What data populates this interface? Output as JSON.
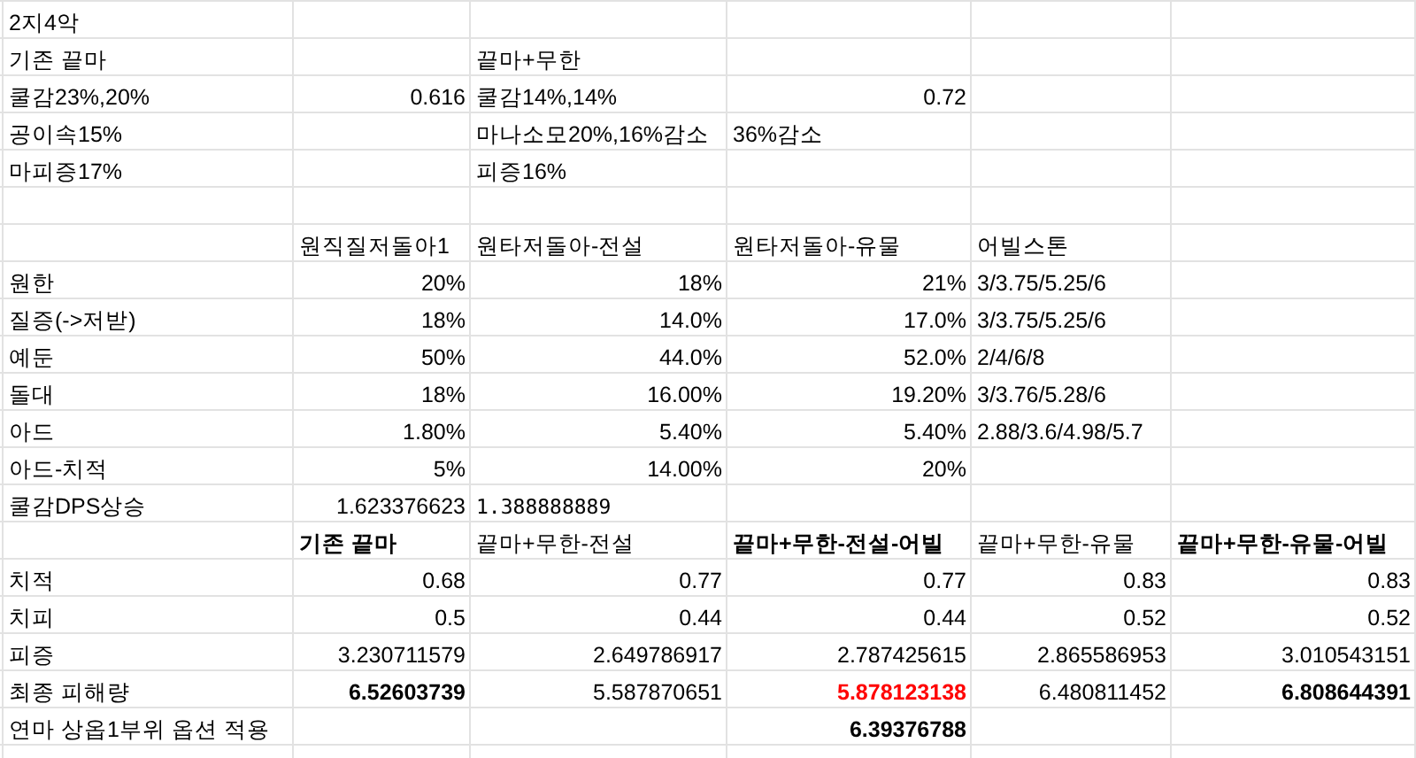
{
  "rows": [
    [
      {
        "t": "2지4악"
      },
      null,
      null,
      null,
      null,
      null
    ],
    [
      {
        "t": "기존 끝마"
      },
      null,
      {
        "t": "끝마+무한"
      },
      null,
      null,
      null
    ],
    [
      {
        "t": "쿨감23%,20%"
      },
      {
        "t": "0.616",
        "right": true
      },
      {
        "t": "쿨감14%,14%"
      },
      {
        "t": "0.72",
        "right": true
      },
      null,
      null
    ],
    [
      {
        "t": "공이속15%"
      },
      null,
      {
        "t": "마나소모20%,16%감소"
      },
      {
        "t": "36%감소"
      },
      null,
      null
    ],
    [
      {
        "t": "마피증17%"
      },
      null,
      {
        "t": "피증16%"
      },
      null,
      null,
      null
    ],
    [
      null,
      null,
      null,
      null,
      null,
      null
    ],
    [
      null,
      {
        "t": "원직질저돌아1"
      },
      {
        "t": "원타저돌아-전설"
      },
      {
        "t": "원타저돌아-유물"
      },
      {
        "t": "어빌스톤"
      },
      null
    ],
    [
      {
        "t": "원한"
      },
      {
        "t": "20%",
        "right": true
      },
      {
        "t": "18%",
        "right": true
      },
      {
        "t": "21%",
        "right": true
      },
      {
        "t": "3/3.75/5.25/6"
      },
      null
    ],
    [
      {
        "t": "질증(->저받)"
      },
      {
        "t": "18%",
        "right": true
      },
      {
        "t": "14.0%",
        "right": true
      },
      {
        "t": "17.0%",
        "right": true
      },
      {
        "t": "3/3.75/5.25/6"
      },
      null
    ],
    [
      {
        "t": "예둔"
      },
      {
        "t": "50%",
        "right": true
      },
      {
        "t": "44.0%",
        "right": true
      },
      {
        "t": "52.0%",
        "right": true
      },
      {
        "t": "2/4/6/8"
      },
      null
    ],
    [
      {
        "t": "돌대"
      },
      {
        "t": "18%",
        "right": true
      },
      {
        "t": "16.00%",
        "right": true
      },
      {
        "t": "19.20%",
        "right": true
      },
      {
        "t": "3/3.76/5.28/6"
      },
      null
    ],
    [
      {
        "t": "아드"
      },
      {
        "t": "1.80%",
        "right": true
      },
      {
        "t": "5.40%",
        "right": true
      },
      {
        "t": "5.40%",
        "right": true
      },
      {
        "t": "2.88/3.6/4.98/5.7"
      },
      null
    ],
    [
      {
        "t": "아드-치적"
      },
      {
        "t": "5%",
        "right": true
      },
      {
        "t": "14.00%",
        "right": true
      },
      {
        "t": "20%",
        "right": true
      },
      null,
      null
    ],
    [
      {
        "t": "쿨감DPS상승"
      },
      {
        "t": "1.623376623",
        "right": true
      },
      {
        "t": "1.388888889",
        "mono": true
      },
      null,
      null,
      null
    ],
    [
      null,
      {
        "t": "기존 끝마",
        "b": true
      },
      {
        "t": "끝마+무한-전설"
      },
      {
        "t": "끝마+무한-전설-어빌",
        "b": true
      },
      {
        "t": "끝마+무한-유물"
      },
      {
        "t": "끝마+무한-유물-어빌",
        "b": true
      }
    ],
    [
      {
        "t": "치적"
      },
      {
        "t": "0.68",
        "right": true
      },
      {
        "t": "0.77",
        "right": true
      },
      {
        "t": "0.77",
        "right": true
      },
      {
        "t": "0.83",
        "right": true
      },
      {
        "t": "0.83",
        "right": true
      }
    ],
    [
      {
        "t": "치피"
      },
      {
        "t": "0.5",
        "right": true
      },
      {
        "t": "0.44",
        "right": true
      },
      {
        "t": "0.44",
        "right": true
      },
      {
        "t": "0.52",
        "right": true
      },
      {
        "t": "0.52",
        "right": true
      }
    ],
    [
      {
        "t": "피증"
      },
      {
        "t": "3.230711579",
        "right": true
      },
      {
        "t": "2.649786917",
        "right": true
      },
      {
        "t": "2.787425615",
        "right": true
      },
      {
        "t": "2.865586953",
        "right": true
      },
      {
        "t": "3.010543151",
        "right": true
      }
    ],
    [
      {
        "t": "최종 피해량"
      },
      {
        "t": "6.52603739",
        "right": true,
        "b": true
      },
      {
        "t": "5.587870651",
        "right": true
      },
      {
        "t": "5.878123138",
        "right": true,
        "b": true,
        "red": true
      },
      {
        "t": "6.480811452",
        "right": true
      },
      {
        "t": "6.808644391",
        "right": true,
        "b": true
      }
    ],
    [
      {
        "t": "연마 상옵1부위 옵션 적용"
      },
      null,
      null,
      {
        "t": "6.39376788",
        "right": true,
        "b": true
      },
      null,
      null
    ]
  ]
}
